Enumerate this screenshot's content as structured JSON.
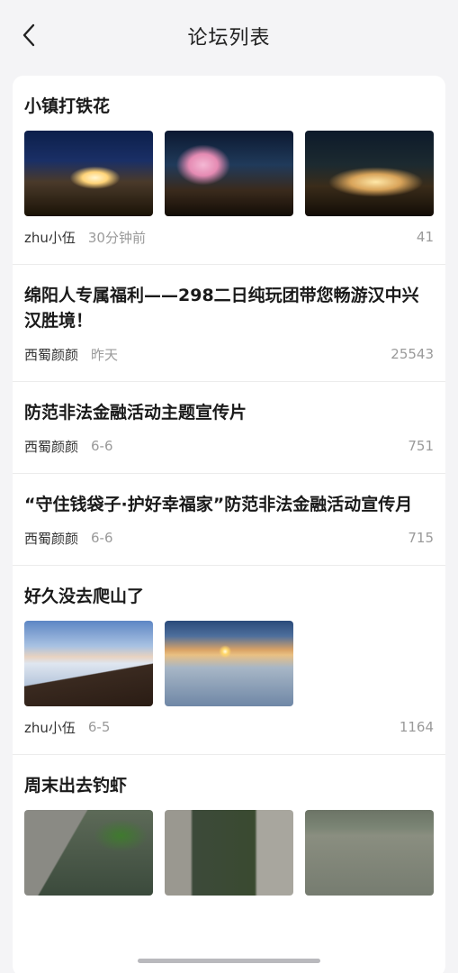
{
  "header": {
    "title": "论坛列表",
    "back_icon": "chevron-left-icon"
  },
  "posts": [
    {
      "title": "小镇打铁花",
      "author": "zhu小伍",
      "time": "30分钟前",
      "views": "41",
      "images": 3
    },
    {
      "title": "绵阳人专属福利——298二日纯玩团带您畅游汉中兴汉胜境！",
      "author": "西蜀颜颜",
      "time": "昨天",
      "views": "25543",
      "images": 0
    },
    {
      "title": "防范非法金融活动主题宣传片",
      "author": "西蜀颜颜",
      "time": "6-6",
      "views": "751",
      "images": 0
    },
    {
      "title": "“守住钱袋子·护好幸福家”防范非法金融活动宣传月",
      "author": "西蜀颜颜",
      "time": "6-6",
      "views": "715",
      "images": 0
    },
    {
      "title": "好久没去爬山了",
      "author": "zhu小伍",
      "time": "6-5",
      "views": "1164",
      "images": 2
    },
    {
      "title": "周末出去钓虾",
      "author": "",
      "time": "",
      "views": "",
      "images": 3
    }
  ]
}
